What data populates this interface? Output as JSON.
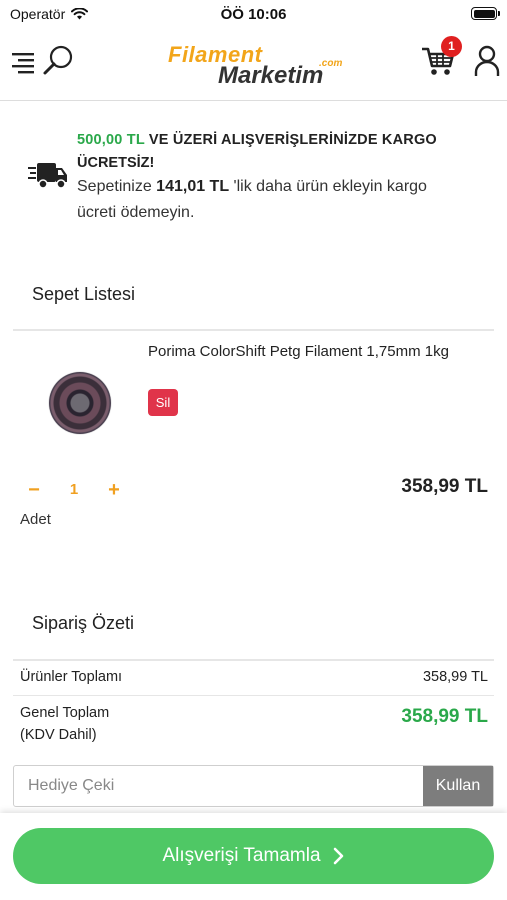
{
  "status_bar": {
    "carrier": "Operatör",
    "time": "ÖÖ 10:06"
  },
  "header": {
    "logo_line1": "Filament",
    "logo_line2": "Marketim",
    "logo_suffix": ".com",
    "cart_count": "1"
  },
  "shipping_notice": {
    "threshold": "500,00 TL",
    "line1_rest": " VE ÜZERİ ALIŞVERİŞLERİNİZDE KARGO",
    "line2": "ÜCRETSİZ!",
    "line3_prefix": "Sepetinize ",
    "remaining": "141,01 TL",
    "line3_suffix": " 'lik daha ürün ekleyin kargo",
    "line4": "ücreti ödemeyin."
  },
  "cart": {
    "title": "Sepet Listesi",
    "items": [
      {
        "name": "Porima ColorShift Petg Filament 1,75mm 1kg",
        "remove_label": "Sil",
        "quantity": "1",
        "quantity_label": "Adet",
        "price": "358,99 TL"
      }
    ]
  },
  "summary": {
    "title": "Sipariş Özeti",
    "products_total_label": "Ürünler Toplamı",
    "products_total_value": "358,99 TL",
    "grand_total_label_line1": "Genel Toplam",
    "grand_total_label_line2": "(KDV Dahil)",
    "grand_total_value": "358,99 TL"
  },
  "coupon": {
    "placeholder": "Hediye Çeki",
    "apply_label": "Kullan"
  },
  "checkout": {
    "label": "Alışverişi Tamamla"
  },
  "colors": {
    "accent_green": "#2aa84a",
    "button_green": "#4fc865",
    "logo_orange": "#f2a51a",
    "quantity_orange": "#f0a020",
    "remove_red": "#e0344a"
  }
}
